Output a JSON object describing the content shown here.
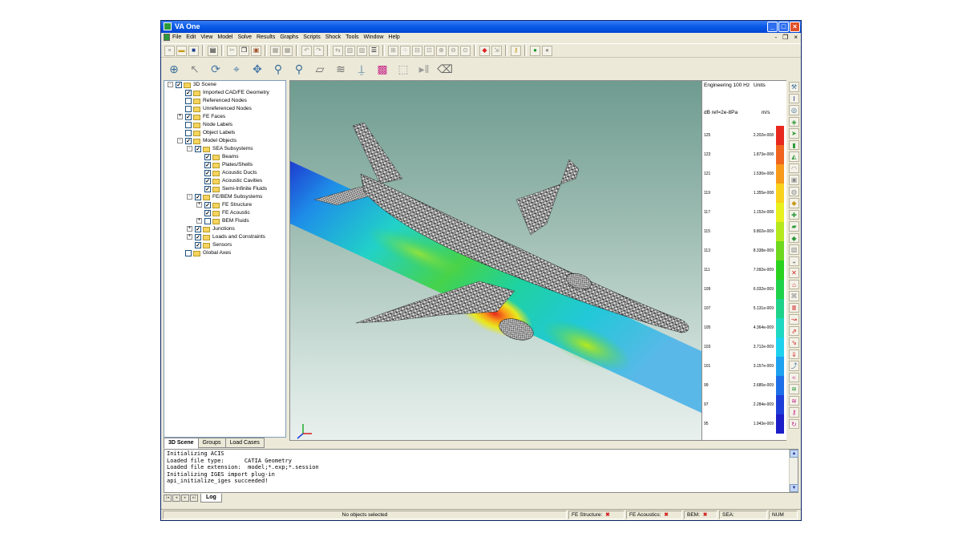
{
  "window": {
    "title": "VA One",
    "minimize": "_",
    "maximize": "□",
    "close": "×"
  },
  "menubar": {
    "items": [
      "File",
      "Edit",
      "View",
      "Model",
      "Solve",
      "Results",
      "Graphs",
      "Scripts",
      "Shock",
      "Tools",
      "Window",
      "Help"
    ],
    "mdi": [
      "-",
      "❐",
      "×"
    ]
  },
  "tree": {
    "items": [
      {
        "label": "3D Scene",
        "level": 0,
        "exp": "-",
        "checked": "✓",
        "folder": true
      },
      {
        "label": "Imported CAD/FE Geometry",
        "level": 1,
        "exp": "",
        "checked": "✓",
        "folder": true
      },
      {
        "label": "Referenced Nodes",
        "level": 1,
        "exp": "",
        "checked": "",
        "folder": true
      },
      {
        "label": "Unreferenced Nodes",
        "level": 1,
        "exp": "",
        "checked": "",
        "folder": true
      },
      {
        "label": "FE Faces",
        "level": 1,
        "exp": "+",
        "checked": "✓",
        "folder": true
      },
      {
        "label": "Node Labels",
        "level": 1,
        "exp": "",
        "checked": "",
        "folder": true
      },
      {
        "label": "Object Labels",
        "level": 1,
        "exp": "",
        "checked": "",
        "folder": true
      },
      {
        "label": "Model Objects",
        "level": 1,
        "exp": "-",
        "checked": "✓",
        "folder": true
      },
      {
        "label": "SEA Subsystems",
        "level": 2,
        "exp": "-",
        "checked": "✓",
        "folder": true
      },
      {
        "label": "Beams",
        "level": 3,
        "exp": "",
        "checked": "✓",
        "folder": true
      },
      {
        "label": "Plates/Shells",
        "level": 3,
        "exp": "",
        "checked": "✓",
        "folder": true
      },
      {
        "label": "Acoustic Ducts",
        "level": 3,
        "exp": "",
        "checked": "✓",
        "folder": true
      },
      {
        "label": "Acoustic Cavities",
        "level": 3,
        "exp": "",
        "checked": "✓",
        "folder": true
      },
      {
        "label": "Semi-Infinite Fluids",
        "level": 3,
        "exp": "",
        "checked": "✓",
        "folder": true
      },
      {
        "label": "FE/BEM Subsystems",
        "level": 2,
        "exp": "-",
        "checked": "✓",
        "folder": true
      },
      {
        "label": "FE Structure",
        "level": 3,
        "exp": "+",
        "checked": "✓",
        "folder": true
      },
      {
        "label": "FE Acoustic",
        "level": 3,
        "exp": "",
        "checked": "✓",
        "folder": true
      },
      {
        "label": "BEM Fluids",
        "level": 3,
        "exp": "+",
        "checked": "",
        "folder": true
      },
      {
        "label": "Junctions",
        "level": 2,
        "exp": "+",
        "checked": "✓",
        "folder": true
      },
      {
        "label": "Loads and Constraints",
        "level": 2,
        "exp": "+",
        "checked": "✓",
        "folder": true
      },
      {
        "label": "Sensors",
        "level": 2,
        "exp": "",
        "checked": "✓",
        "folder": true
      },
      {
        "label": "Global Axes",
        "level": 1,
        "exp": "",
        "checked": "",
        "folder": true
      }
    ],
    "tabs": [
      "3D Scene",
      "Groups",
      "Load Cases"
    ]
  },
  "legend": {
    "title": "Engineering 100 Hz",
    "units_label": "Units",
    "ref_label": "dB ref=2e-8Pa",
    "unit": "m/s",
    "rows": [
      {
        "db": "125",
        "val": "2.202e-008",
        "color": "#e8281e"
      },
      {
        "db": "123",
        "val": "1.873e-008",
        "color": "#f0641e"
      },
      {
        "db": "121",
        "val": "1.530e-008",
        "color": "#f89a1a"
      },
      {
        "db": "119",
        "val": "1.355e-008",
        "color": "#f8d21c"
      },
      {
        "db": "117",
        "val": "1.152e-008",
        "color": "#e8f01e"
      },
      {
        "db": "115",
        "val": "9.802e-009",
        "color": "#b6e81e"
      },
      {
        "db": "113",
        "val": "8.338e-009",
        "color": "#6ed81e"
      },
      {
        "db": "111",
        "val": "7.092e-009",
        "color": "#2ad21e"
      },
      {
        "db": "109",
        "val": "6.032e-009",
        "color": "#1ed24a"
      },
      {
        "db": "107",
        "val": "5.131e-009",
        "color": "#1ed28a"
      },
      {
        "db": "105",
        "val": "4.364e-009",
        "color": "#1ed8c2"
      },
      {
        "db": "103",
        "val": "3.712e-009",
        "color": "#1ed2ee"
      },
      {
        "db": "101",
        "val": "3.157e-009",
        "color": "#1ea2f0"
      },
      {
        "db": "99",
        "val": "2.685e-009",
        "color": "#1e70e8"
      },
      {
        "db": "97",
        "val": "2.284e-009",
        "color": "#1e40d8"
      },
      {
        "db": "95",
        "val": "1.943e-009",
        "color": "#1e1ec8"
      }
    ]
  },
  "log": {
    "text": "Initializing ACIS\nLoaded file type:      CATIA Geometry\nLoaded file extension:  model;*.exp;*.session\nInitializing IGES import plug-in\napi_initialize_iges succeeded!",
    "tab": "Log"
  },
  "status": {
    "selection": "No objects selected",
    "fe_structure": "FE Structure:",
    "fe_acoustics": "FE Acoustics:",
    "bem": "BEM:",
    "sea": "SEA:",
    "num": "NUM",
    "x_mark": "✖"
  },
  "toolbar1_icons": [
    "new",
    "open",
    "save",
    "print",
    "cut",
    "copy",
    "paste",
    "undo",
    "redo",
    "grid",
    "zoom-in",
    "zoom-out",
    "zoom-fit",
    "paint",
    "key",
    "run",
    "stop"
  ],
  "toolbar2_icons": [
    "target",
    "pointer",
    "rotate",
    "crosshair",
    "pan",
    "zoom",
    "zoom-region",
    "grid",
    "stack",
    "axis",
    "palette",
    "select-box",
    "play",
    "eraser"
  ]
}
